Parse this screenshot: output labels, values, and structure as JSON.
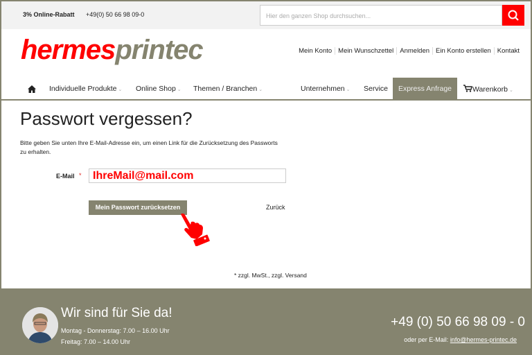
{
  "topbar": {
    "rabatt": "3% Online-Rabatt",
    "phone": "+49(0) 50 66 98 09-0",
    "search_placeholder": "Hier den ganzen Shop durchsuchen..."
  },
  "logo": {
    "part1": "hermes",
    "part2": "printec"
  },
  "toplinks": [
    "Mein Konto",
    "Mein Wunschzettel",
    "Anmelden",
    "Ein Konto erstellen",
    "Kontakt"
  ],
  "nav": {
    "items": [
      "Individuelle Produkte",
      "Online Shop",
      "Themen / Branchen",
      "Unternehmen",
      "Service",
      "Express Anfrage",
      "Warenkorb"
    ]
  },
  "main": {
    "title": "Passwort vergessen?",
    "intro": "Bitte geben Sie unten Ihre E-Mail-Adresse ein, um einen Link für die Zurücksetzung des Passworts zu erhalten.",
    "email_label": "E-Mail",
    "required": "*",
    "email_value": "IhreMail@mail.com",
    "submit": "Mein Passwort zurücksetzen",
    "back": "Zurück",
    "note": "* zzgl. MwSt., zzgl. Versand"
  },
  "footer": {
    "title": "Wir sind für Sie da!",
    "hours1": "Montag - Donnerstag: 7.00 – 16.00 Uhr",
    "hours2": "Freitag: 7.00 – 14.00 Uhr",
    "phone": "+49 (0) 50 66 98 09 - 0",
    "mail_prefix": "oder per E-Mail: ",
    "mail": "info@hermes-printec.de"
  },
  "colors": {
    "brand_red": "#ff0000",
    "brand_olive": "#85846f"
  }
}
